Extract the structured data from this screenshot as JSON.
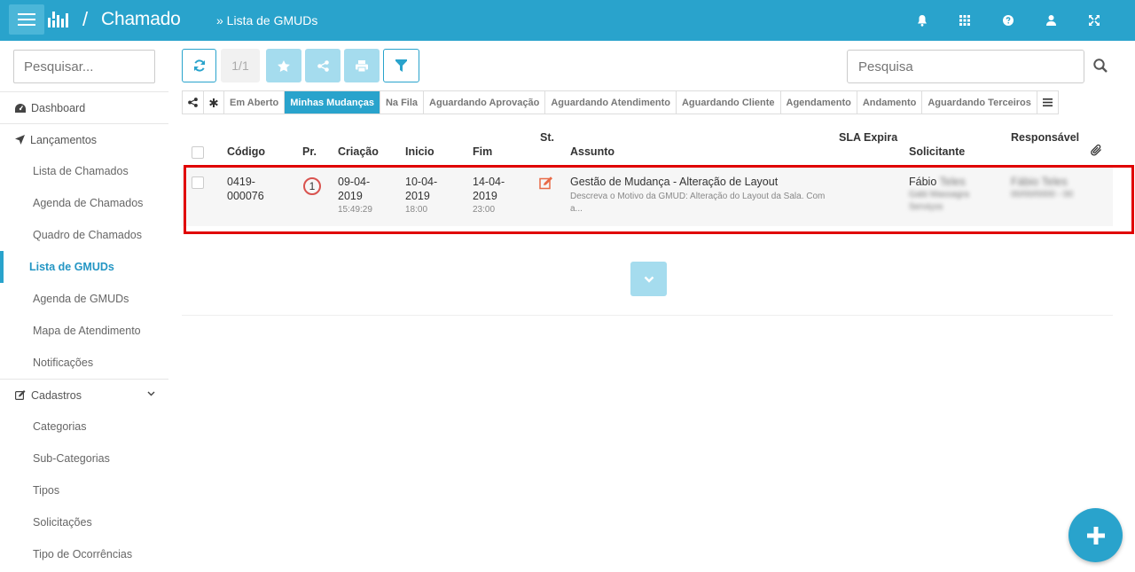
{
  "header": {
    "app_title": "Chamado",
    "slash": "/",
    "breadcrumb": "» Lista de GMUDs"
  },
  "sidebar": {
    "search_placeholder": "Pesquisar...",
    "items": [
      {
        "label": "Dashboard",
        "icon": "dashboard-icon",
        "level": "top"
      },
      {
        "label": "Lançamentos",
        "icon": "location-arrow-icon",
        "level": "top"
      },
      {
        "label": "Lista de Chamados",
        "level": "sub"
      },
      {
        "label": "Agenda de Chamados",
        "level": "sub"
      },
      {
        "label": "Quadro de Chamados",
        "level": "sub"
      },
      {
        "label": "Lista de GMUDs",
        "level": "sub",
        "active": true
      },
      {
        "label": "Agenda de GMUDs",
        "level": "sub"
      },
      {
        "label": "Mapa de Atendimento",
        "level": "sub"
      },
      {
        "label": "Notificações",
        "level": "sub"
      },
      {
        "label": "Cadastros",
        "icon": "edit-icon",
        "level": "top"
      },
      {
        "label": "Categorias",
        "level": "sub"
      },
      {
        "label": "Sub-Categorias",
        "level": "sub"
      },
      {
        "label": "Tipos",
        "level": "sub"
      },
      {
        "label": "Solicitações",
        "level": "sub"
      },
      {
        "label": "Tipo de Ocorrências",
        "level": "sub"
      }
    ]
  },
  "toolbar": {
    "page_indicator": "1/1",
    "search_placeholder": "Pesquisa"
  },
  "tabs": [
    "Em Aberto",
    "Minhas Mudanças",
    "Na Fila",
    "Aguardando Aprovação",
    "Aguardando Atendimento",
    "Aguardando Cliente",
    "Agendamento",
    "Andamento",
    "Aguardando Terceiros"
  ],
  "active_tab": "Minhas Mudanças",
  "table": {
    "headers": {
      "codigo": "Código",
      "pr": "Pr.",
      "criacao": "Criação",
      "inicio": "Inicio",
      "fim": "Fim",
      "st": "St.",
      "assunto": "Assunto",
      "sla": "SLA Expira",
      "solicitante": "Solicitante",
      "responsavel": "Responsável"
    },
    "rows": [
      {
        "codigo_1": "0419-",
        "codigo_2": "000076",
        "prioridade": "1",
        "criacao_1": "09-04-",
        "criacao_2": "2019",
        "criacao_hora": "15:49:29",
        "inicio_1": "10-04-",
        "inicio_2": "2019",
        "inicio_hora": "18:00",
        "fim_1": "14-04-",
        "fim_2": "2019",
        "fim_hora": "23:00",
        "status_icon": "edit-square-icon",
        "assunto": "Gestão de Mudança - Alteração de Layout",
        "descricao_1": "Descreva o Motivo da GMUD: Alteração do Layout da Sala. Com",
        "descricao_2": "a...",
        "solicitante": "Fábio",
        "solicitante_blur": "Teles",
        "solicitante_sub_1": "Gabi Massagra",
        "solicitante_sub_2": "Serviços",
        "responsavel_blur": "Fábio Teles",
        "responsavel_sub_blur": "00/00/0000 - 00"
      }
    ]
  },
  "colors": {
    "primary": "#29a3cc",
    "primary_light": "#a5dcee",
    "highlight": "#e00000",
    "priority": "#d9534f",
    "status": "#e86a47"
  }
}
